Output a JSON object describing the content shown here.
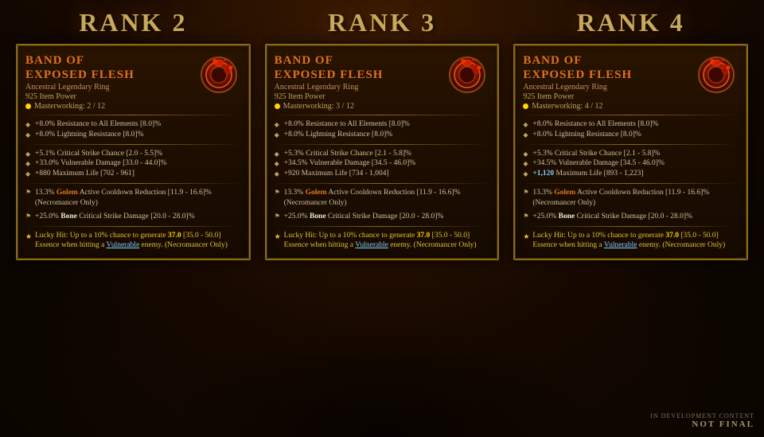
{
  "background": {
    "color": "#1a0d00"
  },
  "ranks": [
    {
      "rank_label": "Rank 2",
      "card": {
        "title_line1": "Band of",
        "title_line2": "Exposed Flesh",
        "subtitle": "Ancestral Legendary Ring",
        "item_power": "925 Item Power",
        "masterworking": "Masterworking: 2 / 12",
        "stats_group1": [
          "+8.0% Resistance to All Elements [8.0]%",
          "+8.0% Lightning Resistance [8.0]%"
        ],
        "stats_group2": [
          "+5.1% Critical Strike Chance [2.0 - 5.5]%",
          "+33.0% Vulnerable Damage [33.0 - 44.0]%",
          "+880 Maximum Life [702 - 961]"
        ],
        "stats_group3": [
          "13.3% Golem Active Cooldown Reduction [11.9 - 16.6]% (Necromancer Only)"
        ],
        "stats_group4": [
          "+25.0% Bone Critical Strike Damage [20.0 - 28.0]%"
        ],
        "lucky_hit": "Lucky Hit: Up to a 10% chance to generate 37.0 [35.0 - 50.0] Essence when hitting a Vulnerable enemy. (Necromancer Only)",
        "lucky_hit_number": "37.0",
        "lucky_hit_range": "[35.0 - 50.0]"
      }
    },
    {
      "rank_label": "Rank 3",
      "card": {
        "title_line1": "Band of",
        "title_line2": "Exposed Flesh",
        "subtitle": "Ancestral Legendary Ring",
        "item_power": "925 Item Power",
        "masterworking": "Masterworking: 3 / 12",
        "stats_group1": [
          "+8.0% Resistance to All Elements [8.0]%",
          "+8.0% Lightning Resistance [8.0]%"
        ],
        "stats_group2": [
          "+5.3% Critical Strike Chance [2.1 - 5.8]%",
          "+34.5% Vulnerable Damage [34.5 - 46.0]%",
          "+920 Maximum Life [734 - 1,004]"
        ],
        "stats_group3": [
          "13.3% Golem Active Cooldown Reduction [11.9 - 16.6]% (Necromancer Only)"
        ],
        "stats_group4": [
          "+25.0% Bone Critical Strike Damage [20.0 - 28.0]%"
        ],
        "lucky_hit": "Lucky Hit: Up to a 10% chance to generate 37.0 [35.0 - 50.0] Essence when hitting a Vulnerable enemy. (Necromancer Only)",
        "lucky_hit_number": "37.0",
        "lucky_hit_range": "[35.0 - 50.0]"
      }
    },
    {
      "rank_label": "Rank 4",
      "card": {
        "title_line1": "Band of",
        "title_line2": "Exposed Flesh",
        "subtitle": "Ancestral Legendary Ring",
        "item_power": "925 Item Power",
        "masterworking": "Masterworking: 4 / 12",
        "stats_group1": [
          "+8.0% Resistance to All Elements [8.0]%",
          "+8.0% Lightning Resistance [8.0]%"
        ],
        "stats_group2": [
          "+5.3% Critical Strike Chance [2.1 - 5.8]%",
          "+34.5% Vulnerable Damage [34.5 - 46.0]%",
          "+1,120 Maximum Life [893 - 1,223]"
        ],
        "stats_group3": [
          "13.3% Golem Active Cooldown Reduction [11.9 - 16.6]% (Necromancer Only)"
        ],
        "stats_group4": [
          "+25.0% Bone Critical Strike Damage [20.0 - 28.0]%"
        ],
        "lucky_hit": "Lucky Hit: Up to a 10% chance to generate 37.0 [35.0 - 50.0] Essence when hitting a Vulnerable enemy. (Necromancer Only)",
        "lucky_hit_number": "37.0",
        "lucky_hit_range": "[35.0 - 50.0]",
        "highlight_stat": "+1,120"
      }
    }
  ],
  "watermark": {
    "line1": "In Development Content",
    "line2": "Not Final"
  }
}
